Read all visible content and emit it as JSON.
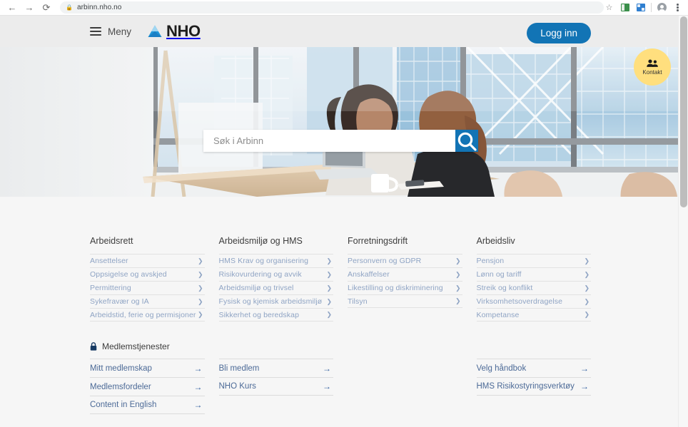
{
  "browser": {
    "back_icon": "back-arrow-icon",
    "forward_icon": "forward-arrow-icon",
    "reload_icon": "reload-icon",
    "lock_glyph": "ὑ2",
    "url": "arbinn.nho.no",
    "bookmark_icon": "star-icon",
    "menu_icon": "kebab-menu-icon"
  },
  "header": {
    "menu_label": "Meny",
    "brand": "NHO",
    "login_label": "Logg inn"
  },
  "hero": {
    "search_placeholder": "Søk i Arbinn",
    "search_value": "",
    "search_icon": "magnifier-icon"
  },
  "kontakt": {
    "label": "Kontakt",
    "icon": "people-icon",
    "color": "#ffdf7e"
  },
  "categories": [
    {
      "title": "Arbeidsrett",
      "links": [
        "Ansettelser",
        "Oppsigelse og avskjed",
        "Permittering",
        "Sykefravær og IA",
        "Arbeidstid, ferie og permisjoner"
      ]
    },
    {
      "title": "Arbeidsmiljø og HMS",
      "links": [
        "HMS Krav og organisering",
        "Risikovurdering og avvik",
        "Arbeidsmiljø og trivsel",
        "Fysisk og kjemisk arbeidsmiljø",
        "Sikkerhet og beredskap"
      ]
    },
    {
      "title": "Forretningsdrift",
      "links": [
        "Personvern og GDPR",
        "Anskaffelser",
        "Likestilling og diskriminering",
        "Tilsyn"
      ]
    },
    {
      "title": "Arbeidsliv",
      "links": [
        "Pensjon",
        "Lønn og tariff",
        "Streik og konflikt",
        "Virksomhetsoverdragelse",
        "Kompetanse"
      ]
    }
  ],
  "member_services": {
    "heading": "Medlemstjenester",
    "lock_icon": "lock-icon",
    "columns": [
      [
        "Mitt medlemskap",
        "Medlemsfordeler",
        "Content in English"
      ],
      [
        "Bli medlem",
        "NHO Kurs"
      ],
      [],
      [
        "Velg håndbok",
        "HMS Risikostyringsverktøy"
      ]
    ]
  },
  "colors": {
    "accent": "#1274b5",
    "link": "#8fa4c4",
    "member_link": "#4c6a97",
    "page_bg": "#f6f6f6",
    "header_bg": "#ececec"
  }
}
